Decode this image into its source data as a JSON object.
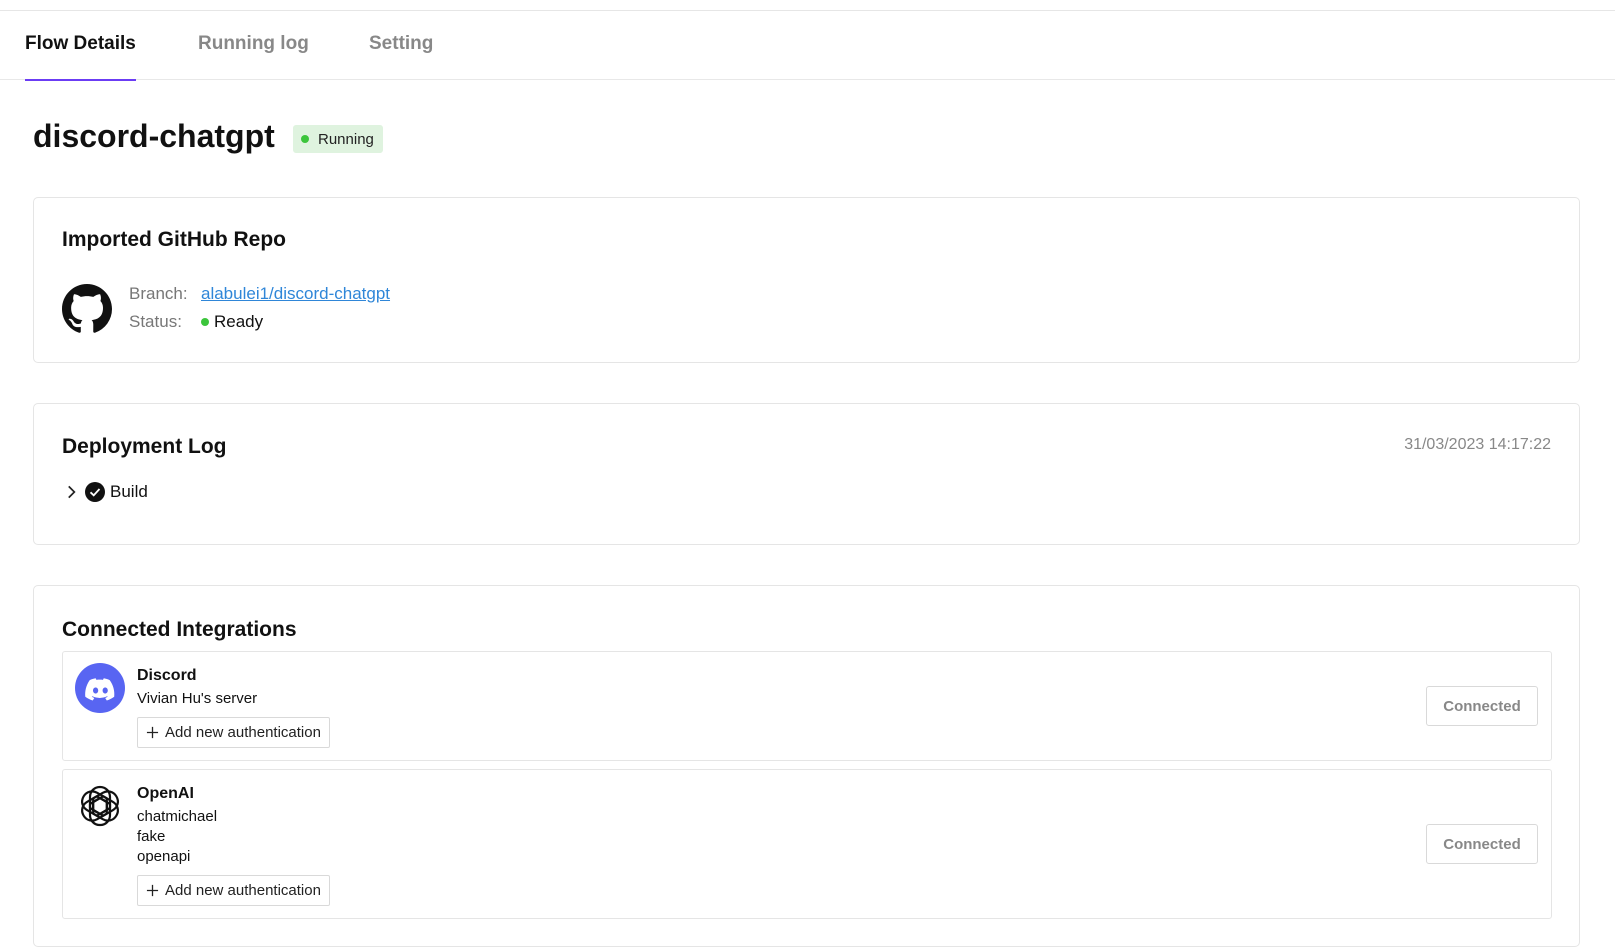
{
  "tabs": [
    {
      "label": "Flow Details",
      "active": true
    },
    {
      "label": "Running log",
      "active": false
    },
    {
      "label": "Setting",
      "active": false
    }
  ],
  "flow": {
    "name": "discord-chatgpt",
    "status": "Running",
    "status_color": "#3cc53c"
  },
  "github": {
    "title": "Imported GitHub Repo",
    "icon": "github-icon",
    "branch_label": "Branch:",
    "branch_value": "alabulei1/discord-chatgpt",
    "status_label": "Status:",
    "status_value": "Ready"
  },
  "deployment": {
    "title": "Deployment Log",
    "timestamp": "31/03/2023 14:17:22",
    "steps": [
      {
        "label": "Build",
        "state": "success",
        "icon": "check-circle-icon"
      }
    ]
  },
  "integrations": {
    "title": "Connected Integrations",
    "add_auth_label": "Add new authentication",
    "items": [
      {
        "name": "Discord",
        "icon": "discord-icon",
        "brand_color": "#5865f2",
        "accounts": [
          "Vivian Hu's server"
        ],
        "button_label": "Connected"
      },
      {
        "name": "OpenAI",
        "icon": "openai-icon",
        "accounts": [
          "chatmichael",
          "fake",
          "openapi"
        ],
        "button_label": "Connected"
      }
    ]
  },
  "colors": {
    "accent": "#6b3cf4",
    "link": "#2f86d8",
    "status_green": "#3cc53c",
    "pill_bg": "#dff3df"
  }
}
